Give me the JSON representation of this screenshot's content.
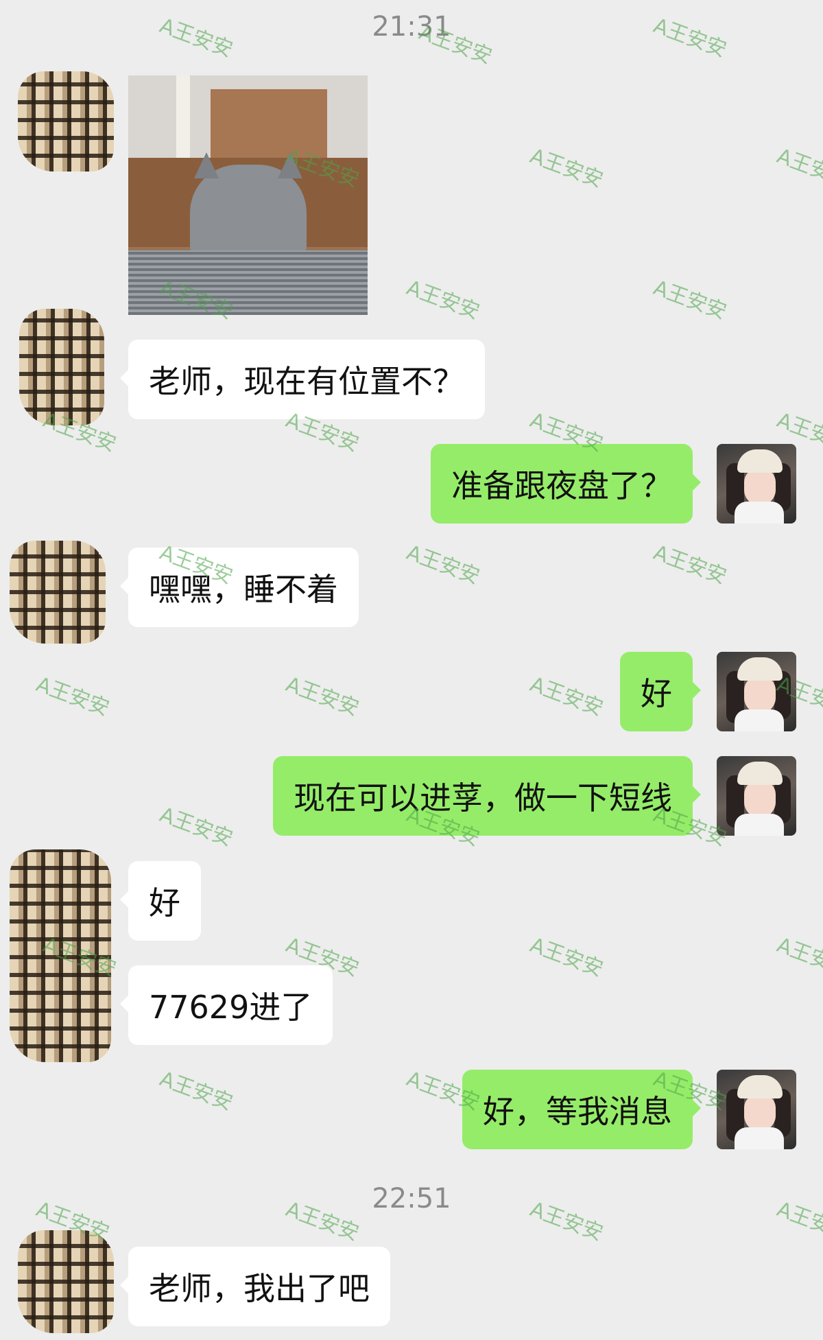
{
  "timestamps": {
    "first": "21:31",
    "second": "22:51"
  },
  "messages": {
    "m2": "老师，现在有位置不？",
    "m3": "准备跟夜盘了？",
    "m4": "嘿嘿，睡不着",
    "m5": "好",
    "m6": "现在可以进莩，做一下短线",
    "m7": "好",
    "m8": "77629进了",
    "m9": "好，等我消息",
    "m10": "老师，我出了吧"
  },
  "watermark": {
    "text": "A王安安"
  },
  "colors": {
    "background": "#ededed",
    "incoming_bubble": "#ffffff",
    "outgoing_bubble": "#95ec69",
    "watermark": "#4ea54a"
  }
}
